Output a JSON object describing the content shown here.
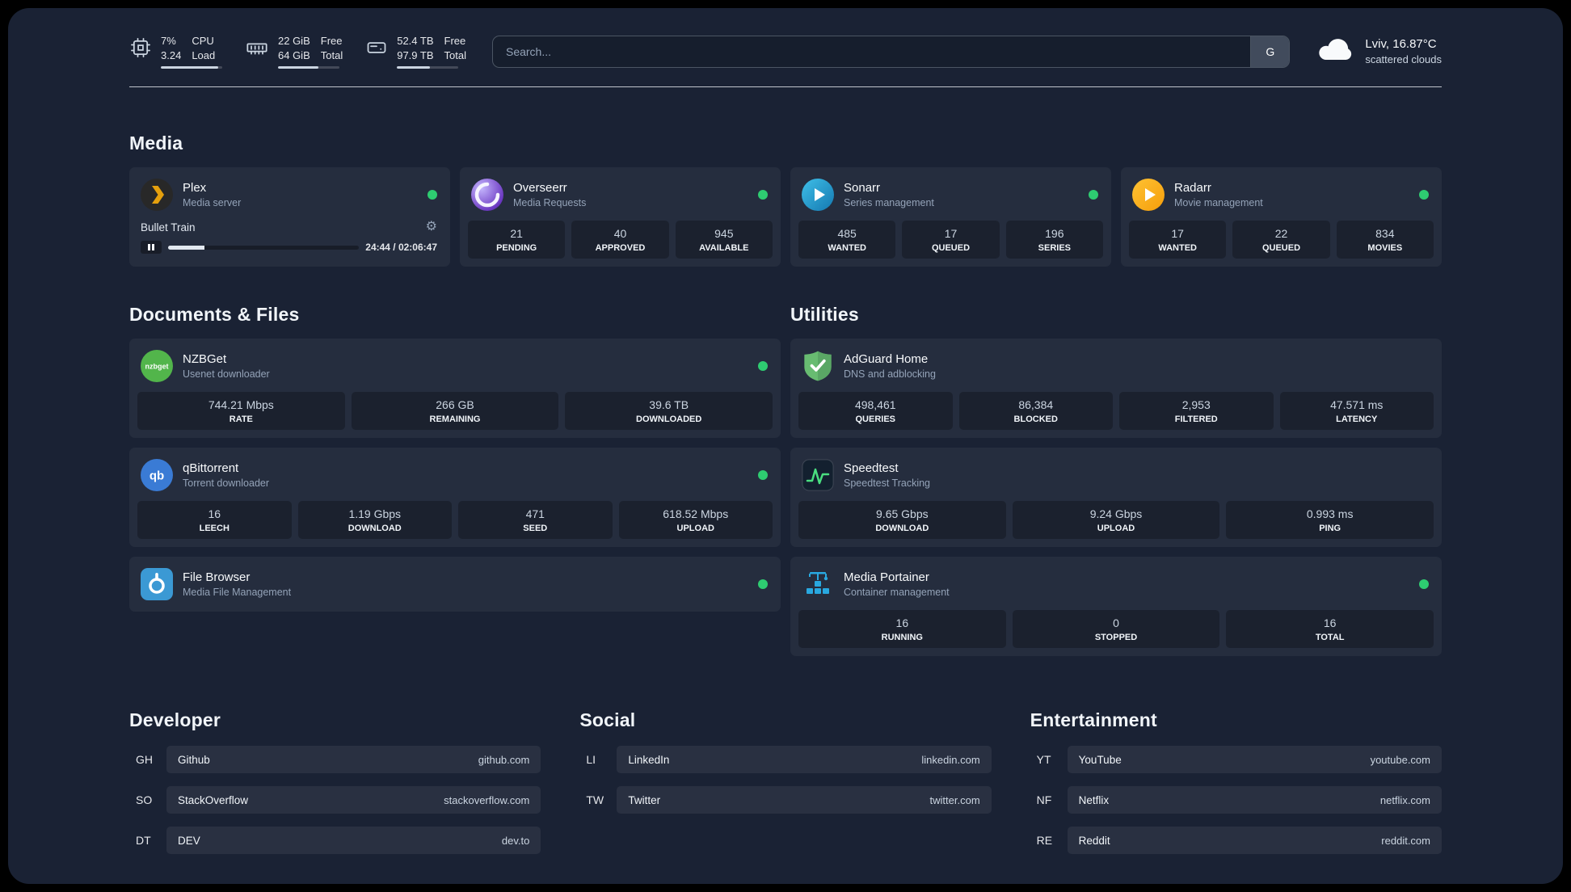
{
  "theme": {
    "background": "#1a2234",
    "status_green": "#2ecc71",
    "divider": "#d1d5db"
  },
  "topbar": {
    "cpu": {
      "usage": "7%",
      "load": "3.24",
      "label_top": "CPU",
      "label_bottom": "Load"
    },
    "memory": {
      "free": "22 GiB",
      "total": "64 GiB",
      "label_top": "Free",
      "label_bottom": "Total"
    },
    "disk": {
      "free": "52.4 TB",
      "total": "97.9 TB",
      "label_top": "Free",
      "label_bottom": "Total"
    },
    "search": {
      "placeholder": "Search...",
      "provider": "G"
    },
    "weather": {
      "location": "Lviv, 16.87°C",
      "condition": "scattered clouds"
    }
  },
  "sections": {
    "media": "Media",
    "documents": "Documents & Files",
    "utilities": "Utilities"
  },
  "services": {
    "plex": {
      "name": "Plex",
      "desc": "Media server",
      "now_playing": "Bullet Train",
      "time": "24:44 / 02:06:47"
    },
    "overseerr": {
      "name": "Overseerr",
      "desc": "Media Requests",
      "stats": [
        {
          "value": "21",
          "label": "PENDING"
        },
        {
          "value": "40",
          "label": "APPROVED"
        },
        {
          "value": "945",
          "label": "AVAILABLE"
        }
      ]
    },
    "sonarr": {
      "name": "Sonarr",
      "desc": "Series management",
      "stats": [
        {
          "value": "485",
          "label": "WANTED"
        },
        {
          "value": "17",
          "label": "QUEUED"
        },
        {
          "value": "196",
          "label": "SERIES"
        }
      ]
    },
    "radarr": {
      "name": "Radarr",
      "desc": "Movie management",
      "stats": [
        {
          "value": "17",
          "label": "WANTED"
        },
        {
          "value": "22",
          "label": "QUEUED"
        },
        {
          "value": "834",
          "label": "MOVIES"
        }
      ]
    },
    "nzbget": {
      "name": "NZBGet",
      "desc": "Usenet downloader",
      "stats": [
        {
          "value": "744.21 Mbps",
          "label": "RATE"
        },
        {
          "value": "266 GB",
          "label": "REMAINING"
        },
        {
          "value": "39.6 TB",
          "label": "DOWNLOADED"
        }
      ]
    },
    "qbittorrent": {
      "name": "qBittorrent",
      "desc": "Torrent downloader",
      "stats": [
        {
          "value": "16",
          "label": "LEECH"
        },
        {
          "value": "1.19 Gbps",
          "label": "DOWNLOAD"
        },
        {
          "value": "471",
          "label": "SEED"
        },
        {
          "value": "618.52 Mbps",
          "label": "UPLOAD"
        }
      ]
    },
    "filebrowser": {
      "name": "File Browser",
      "desc": "Media File Management"
    },
    "adguard": {
      "name": "AdGuard Home",
      "desc": "DNS and adblocking",
      "stats": [
        {
          "value": "498,461",
          "label": "QUERIES"
        },
        {
          "value": "86,384",
          "label": "BLOCKED"
        },
        {
          "value": "2,953",
          "label": "FILTERED"
        },
        {
          "value": "47.571 ms",
          "label": "LATENCY"
        }
      ]
    },
    "speedtest": {
      "name": "Speedtest",
      "desc": "Speedtest Tracking",
      "stats": [
        {
          "value": "9.65 Gbps",
          "label": "DOWNLOAD"
        },
        {
          "value": "9.24 Gbps",
          "label": "UPLOAD"
        },
        {
          "value": "0.993 ms",
          "label": "PING"
        }
      ]
    },
    "portainer": {
      "name": "Media Portainer",
      "desc": "Container management",
      "stats": [
        {
          "value": "16",
          "label": "RUNNING"
        },
        {
          "value": "0",
          "label": "STOPPED"
        },
        {
          "value": "16",
          "label": "TOTAL"
        }
      ]
    }
  },
  "bookmarks": {
    "developer": {
      "title": "Developer",
      "items": [
        {
          "abbr": "GH",
          "name": "Github",
          "url": "github.com"
        },
        {
          "abbr": "SO",
          "name": "StackOverflow",
          "url": "stackoverflow.com"
        },
        {
          "abbr": "DT",
          "name": "DEV",
          "url": "dev.to"
        }
      ]
    },
    "social": {
      "title": "Social",
      "items": [
        {
          "abbr": "LI",
          "name": "LinkedIn",
          "url": "linkedin.com"
        },
        {
          "abbr": "TW",
          "name": "Twitter",
          "url": "twitter.com"
        }
      ]
    },
    "entertainment": {
      "title": "Entertainment",
      "items": [
        {
          "abbr": "YT",
          "name": "YouTube",
          "url": "youtube.com"
        },
        {
          "abbr": "NF",
          "name": "Netflix",
          "url": "netflix.com"
        },
        {
          "abbr": "RE",
          "name": "Reddit",
          "url": "reddit.com"
        }
      ]
    }
  }
}
